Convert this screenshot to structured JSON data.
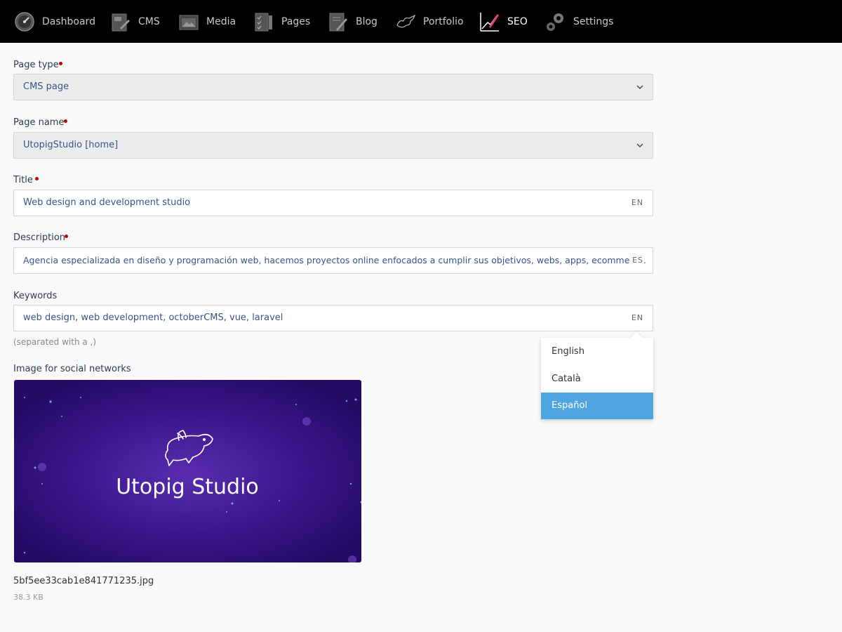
{
  "nav": {
    "items": [
      {
        "label": "Dashboard",
        "icon": "dashboard-gauge-icon"
      },
      {
        "label": "CMS",
        "icon": "cms-icon"
      },
      {
        "label": "Media",
        "icon": "media-icon"
      },
      {
        "label": "Pages",
        "icon": "pages-icon"
      },
      {
        "label": "Blog",
        "icon": "blog-icon"
      },
      {
        "label": "Portfolio",
        "icon": "portfolio-icon"
      },
      {
        "label": "SEO",
        "icon": "seo-chart-icon",
        "active": true
      },
      {
        "label": "Settings",
        "icon": "gears-icon"
      }
    ]
  },
  "form": {
    "page_type": {
      "label": "Page type",
      "value": "CMS page"
    },
    "page_name": {
      "label": "Page name",
      "value": "UtopigStudio [home]"
    },
    "title": {
      "label": "Title",
      "value": "Web design and development studio",
      "lang": "EN"
    },
    "description": {
      "label": "Description",
      "value": "Agencia especializada en diseño y programación web, hacemos proyectos online enfocados a cumplir sus objetivos, webs, apps, ecommerce.",
      "lang": "ES"
    },
    "keywords": {
      "label": "Keywords",
      "value": "web design, web development, octoberCMS, vue, laravel",
      "lang": "EN",
      "hint": "(separated with a ,)"
    },
    "image": {
      "label": "Image for social networks",
      "image_text": "Utopig Studio",
      "file_name": "5bf5ee33cab1e841771235.jpg",
      "file_size": "38.3 KB"
    }
  },
  "language_dropdown": {
    "options": [
      "English",
      "Català",
      "Español"
    ],
    "selected": "Español"
  },
  "colors": {
    "nav_bg": "#000000",
    "accent": "#4ea5e0",
    "required": "#c30000",
    "image_bg": "#2a0f6e"
  }
}
